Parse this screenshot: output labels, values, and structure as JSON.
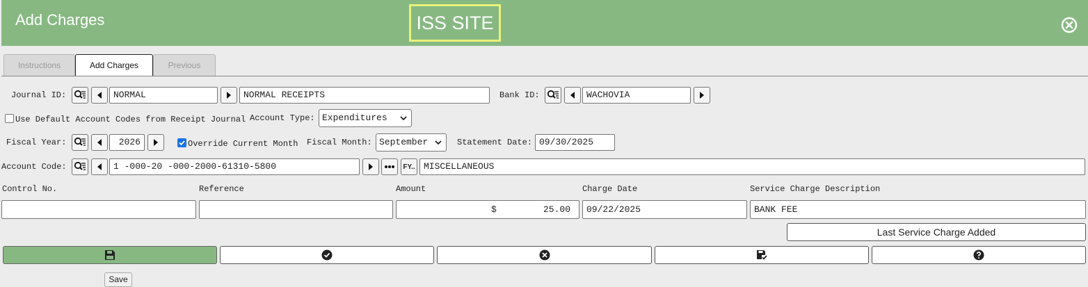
{
  "header": {
    "title": "Add Charges",
    "site_badge": "ISS SITE",
    "close_icon": "close-circle-icon",
    "background": "#87b882"
  },
  "tabs": [
    {
      "label": "Instructions",
      "active": false
    },
    {
      "label": "Add Charges",
      "active": true
    },
    {
      "label": "Previous",
      "active": false
    }
  ],
  "form": {
    "journal_id": {
      "label": "Journal ID:",
      "value": "NORMAL",
      "description": "NORMAL RECEIPTS"
    },
    "bank_id": {
      "label": "Bank ID:",
      "value": "WACHOVIA"
    },
    "use_default": {
      "label": "Use Default Account Codes from Receipt Journal",
      "checked": false
    },
    "account_type": {
      "label": "Account Type:",
      "value": "Expenditures"
    },
    "fiscal_year": {
      "label": "Fiscal Year:",
      "value": "2026"
    },
    "override_month": {
      "label": "Override Current Month",
      "checked": true
    },
    "fiscal_month": {
      "label": "Fiscal Month:",
      "value": "September"
    },
    "statement_date": {
      "label": "Statement Date:",
      "value": "09/30/2025"
    },
    "account_code": {
      "label": "Account Code:",
      "value": "1 -000-20 -000-2000-61310-5800",
      "fy_label": "FY..",
      "description": "MISCELLANEOUS"
    }
  },
  "grid": {
    "headers": {
      "control": "Control No.",
      "reference": "Reference",
      "amount": "Amount",
      "charge_date": "Charge Date",
      "description": "Service Charge Description"
    },
    "values": {
      "control": "",
      "reference": "",
      "amount_symbol": "$",
      "amount": "25.00",
      "charge_date": "09/22/2025",
      "description": "BANK FEE"
    }
  },
  "last_service_charge": "Last Service Charge Added",
  "actions": [
    {
      "name": "save-button",
      "icon": "floppy-icon"
    },
    {
      "name": "accept-button",
      "icon": "check-circle-icon"
    },
    {
      "name": "cancel-button",
      "icon": "x-circle-icon"
    },
    {
      "name": "save-new-button",
      "icon": "floppy-check-icon"
    },
    {
      "name": "help-button",
      "icon": "question-circle-icon"
    }
  ],
  "tooltip": "Save"
}
